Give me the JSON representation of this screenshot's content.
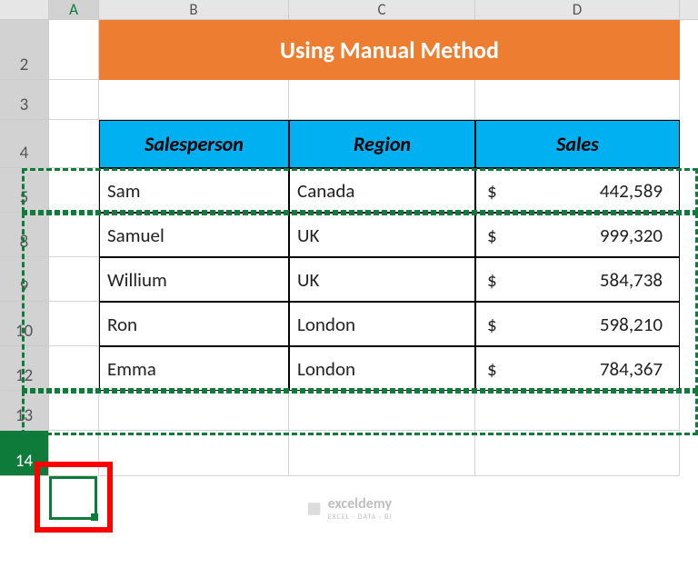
{
  "columns": [
    "A",
    "B",
    "C",
    "D"
  ],
  "rows": [
    "2",
    "3",
    "4",
    "5",
    "8",
    "9",
    "10",
    "12",
    "13",
    "14"
  ],
  "title": "Using Manual Method",
  "headers": {
    "salesperson": "Salesperson",
    "region": "Region",
    "sales": "Sales"
  },
  "data": [
    {
      "name": "Sam",
      "region": "Canada",
      "currency": "$",
      "amount": "442,589"
    },
    {
      "name": "Samuel",
      "region": "UK",
      "currency": "$",
      "amount": "999,320"
    },
    {
      "name": "Willium",
      "region": "UK",
      "currency": "$",
      "amount": "584,738"
    },
    {
      "name": "Ron",
      "region": "London",
      "currency": "$",
      "amount": "598,210"
    },
    {
      "name": "Emma",
      "region": "London",
      "currency": "$",
      "amount": "784,367"
    }
  ],
  "watermark": "exceldemy",
  "watermark_sub": "EXCEL · DATA · BI",
  "colors": {
    "title_bg": "#ED7D31",
    "header_bg": "#00B0F0",
    "selection": "#0f7b3b",
    "highlight": "#ff0000"
  }
}
